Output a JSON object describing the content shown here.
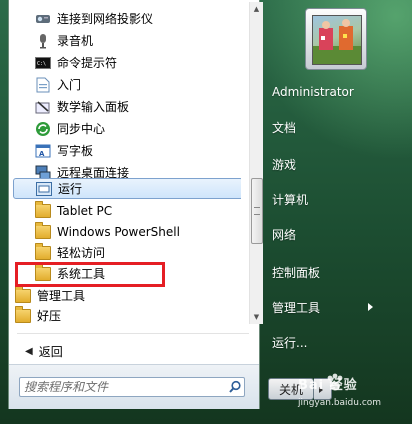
{
  "programs": [
    {
      "label": "连接到网络投影仪",
      "icon": "projector-icon"
    },
    {
      "label": "录音机",
      "icon": "microphone-icon"
    },
    {
      "label": "命令提示符",
      "icon": "command-prompt-icon"
    },
    {
      "label": "入门",
      "icon": "getting-started-icon"
    },
    {
      "label": "数学输入面板",
      "icon": "math-input-icon"
    },
    {
      "label": "同步中心",
      "icon": "sync-center-icon"
    },
    {
      "label": "写字板",
      "icon": "wordpad-icon"
    },
    {
      "label": "远程桌面连接",
      "icon": "remote-desktop-icon"
    },
    {
      "label": "运行",
      "icon": "run-icon"
    },
    {
      "label": "Tablet PC",
      "icon": "folder-icon"
    },
    {
      "label": "Windows PowerShell",
      "icon": "folder-icon"
    },
    {
      "label": "轻松访问",
      "icon": "folder-icon"
    },
    {
      "label": "系统工具",
      "icon": "folder-icon"
    },
    {
      "label": "管理工具",
      "icon": "folder-icon"
    },
    {
      "label": "好压",
      "icon": "folder-icon"
    }
  ],
  "back_label": "返回",
  "search_placeholder": "搜索程序和文件",
  "user": {
    "name": "Administrator"
  },
  "right_items": [
    {
      "label": "文档"
    },
    {
      "label": "游戏"
    },
    {
      "label": "计算机"
    },
    {
      "label": "网络"
    },
    {
      "label": "控制面板"
    },
    {
      "label": "管理工具"
    },
    {
      "label": "运行..."
    }
  ],
  "shutdown_label": "关机",
  "watermark": {
    "logo": "Bai 经验",
    "url": "jingyan.baidu.com"
  },
  "colors": {
    "highlight_box": "#e51e24",
    "selection": "#cfe5fb",
    "panel_bg": "#2c6b49"
  }
}
